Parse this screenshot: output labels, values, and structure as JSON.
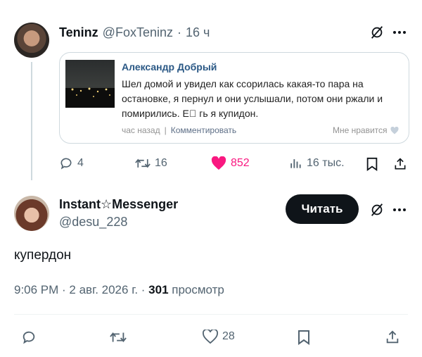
{
  "tweet1": {
    "display_name": "Teninz",
    "handle": "@FoxTeninz",
    "separator": "·",
    "time": "16 ч",
    "embed": {
      "author": "Александр Добрый",
      "text": "Шел домой и увидел как ссорилась какая-то пара на остановке, я пернул и они услышали, потом они ржали и помирились. Е゙ гь я купидон.",
      "time": "час назад",
      "sep": "|",
      "comment_label": "Комментировать",
      "like_label": "Мне нравится"
    },
    "actions": {
      "replies": "4",
      "reposts": "16",
      "likes": "852",
      "views": "16 тыс."
    }
  },
  "tweet2": {
    "display_name": "Instant☆Messenger",
    "handle": "@desu_228",
    "follow_label": "Читать",
    "text": "купердон",
    "timestamp": "9:06 PM · 2 авг. 2026 г. · ",
    "views_count": "301",
    "views_label": " просмотр",
    "actions": {
      "likes": "28"
    }
  },
  "colors": {
    "like_pink": "#f91880",
    "gray": "#536471",
    "vk_blue": "#2a5885"
  }
}
